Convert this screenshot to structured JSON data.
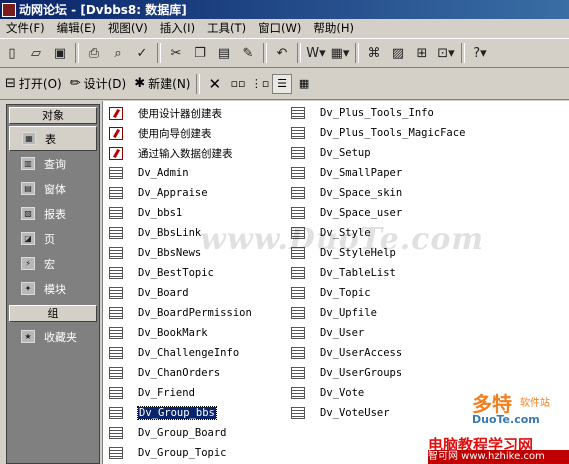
{
  "window": {
    "title": "动网论坛 - [Dvbbs8: 数据库]"
  },
  "menu": [
    "文件(F)",
    "编辑(E)",
    "视图(V)",
    "插入(I)",
    "工具(T)",
    "窗口(W)",
    "帮助(H)"
  ],
  "dbtoolbar": {
    "open": "打开(O)",
    "design": "设计(D)",
    "new": "新建(N)"
  },
  "objects": {
    "header": "对象",
    "items": [
      "表",
      "查询",
      "窗体",
      "报表",
      "页",
      "宏",
      "模块"
    ],
    "groups_header": "组",
    "groups": [
      "收藏夹"
    ]
  },
  "list": {
    "col1": [
      {
        "text": "使用设计器创建表",
        "kind": "shortcut"
      },
      {
        "text": "使用向导创建表",
        "kind": "shortcut"
      },
      {
        "text": "通过输入数据创建表",
        "kind": "shortcut"
      },
      {
        "text": "Dv_Admin",
        "kind": "table"
      },
      {
        "text": "Dv_Appraise",
        "kind": "table"
      },
      {
        "text": "Dv_bbs1",
        "kind": "table"
      },
      {
        "text": "Dv_BbsLink",
        "kind": "table"
      },
      {
        "text": "Dv_BbsNews",
        "kind": "table"
      },
      {
        "text": "Dv_BestTopic",
        "kind": "table"
      },
      {
        "text": "Dv_Board",
        "kind": "table"
      },
      {
        "text": "Dv_BoardPermission",
        "kind": "table"
      },
      {
        "text": "Dv_BookMark",
        "kind": "table"
      },
      {
        "text": "Dv_ChallengeInfo",
        "kind": "table"
      },
      {
        "text": "Dv_ChanOrders",
        "kind": "table"
      },
      {
        "text": "Dv_Friend",
        "kind": "table"
      },
      {
        "text": "Dv_Group_bbs",
        "kind": "table",
        "selected": true
      },
      {
        "text": "Dv_Group_Board",
        "kind": "table"
      },
      {
        "text": "Dv_Group_Topic",
        "kind": "table"
      }
    ],
    "col2": [
      {
        "text": "Dv_Plus_Tools_Info",
        "kind": "table"
      },
      {
        "text": "Dv_Plus_Tools_MagicFace",
        "kind": "table"
      },
      {
        "text": "Dv_Setup",
        "kind": "table"
      },
      {
        "text": "Dv_SmallPaper",
        "kind": "table"
      },
      {
        "text": "Dv_Space_skin",
        "kind": "table"
      },
      {
        "text": "Dv_Space_user",
        "kind": "table"
      },
      {
        "text": "Dv_Style",
        "kind": "table"
      },
      {
        "text": "Dv_StyleHelp",
        "kind": "table"
      },
      {
        "text": "Dv_TableList",
        "kind": "table"
      },
      {
        "text": "Dv_Topic",
        "kind": "table"
      },
      {
        "text": "Dv_Upfile",
        "kind": "table"
      },
      {
        "text": "Dv_User",
        "kind": "table"
      },
      {
        "text": "Dv_UserAccess",
        "kind": "table"
      },
      {
        "text": "Dv_UserGroups",
        "kind": "table"
      },
      {
        "text": "Dv_Vote",
        "kind": "table"
      },
      {
        "text": "Dv_VoteUser",
        "kind": "table"
      }
    ]
  },
  "watermarks": {
    "center": "www.DuoTe.com",
    "corner_big": "多特",
    "corner_small": "软件站",
    "corner_url": "DuoTe.com",
    "ticker_red": "电脑教程学习网",
    "ticker_strip": "智可网 www.hzhike.com"
  },
  "colors": {
    "title_start": "#0a246a",
    "title_end": "#3a6ea5",
    "objbar_bg": "#808080",
    "selection": "#0a246a"
  },
  "icons": [
    "app-icon",
    "new-icon",
    "open-icon",
    "save-icon",
    "print-icon",
    "print-preview-icon",
    "spell-check-icon",
    "cut-icon",
    "copy-icon",
    "paste-icon",
    "format-painter-icon",
    "undo-icon",
    "office-links-icon",
    "analyze-icon",
    "code-icon",
    "properties-icon",
    "relationships-icon",
    "new-object-icon",
    "help-icon",
    "delete-icon",
    "large-icons-icon",
    "small-icons-icon",
    "list-view-icon",
    "details-view-icon"
  ]
}
